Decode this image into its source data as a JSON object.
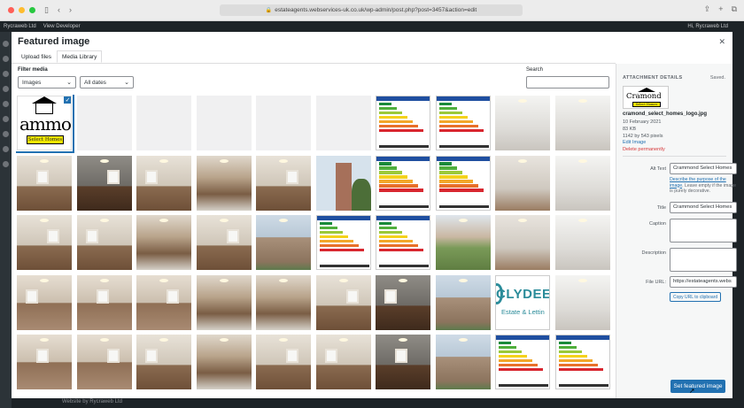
{
  "browser": {
    "url": "estateagents.webservices-uk.co.uk/wp-admin/post.php?post=3457&action=edit"
  },
  "admin_bar": {
    "site_name": "Rycraweb Ltd",
    "view_developer": "View Developer",
    "greeting": "Hi, Rycraweb Ltd"
  },
  "footer_text": "Website by Rycraweb Ltd",
  "modal": {
    "title": "Featured image",
    "tabs": [
      {
        "label": "Upload files",
        "active": false
      },
      {
        "label": "Media Library",
        "active": true
      }
    ],
    "filter_label": "Filter media",
    "filter_type": "Images",
    "filter_date": "All dates",
    "search_label": "Search"
  },
  "grid": {
    "columns": 10,
    "items": [
      {
        "kind": "logo",
        "text": "ammo",
        "bar": "Select Homes",
        "selected": true
      },
      {
        "kind": "blank"
      },
      {
        "kind": "blank"
      },
      {
        "kind": "blank"
      },
      {
        "kind": "blank"
      },
      {
        "kind": "blank"
      },
      {
        "kind": "epc"
      },
      {
        "kind": "epc"
      },
      {
        "kind": "bath"
      },
      {
        "kind": "bath"
      },
      {
        "kind": "room-light"
      },
      {
        "kind": "room-dark"
      },
      {
        "kind": "room-light"
      },
      {
        "kind": "kitchen"
      },
      {
        "kind": "room-light"
      },
      {
        "kind": "tower"
      },
      {
        "kind": "epc"
      },
      {
        "kind": "epc"
      },
      {
        "kind": "hall"
      },
      {
        "kind": "bath"
      },
      {
        "kind": "room-light"
      },
      {
        "kind": "room-light"
      },
      {
        "kind": "kitchen"
      },
      {
        "kind": "room-light"
      },
      {
        "kind": "building"
      },
      {
        "kind": "epc"
      },
      {
        "kind": "epc"
      },
      {
        "kind": "garden"
      },
      {
        "kind": "hall"
      },
      {
        "kind": "bath"
      },
      {
        "kind": "bed"
      },
      {
        "kind": "bed"
      },
      {
        "kind": "bed"
      },
      {
        "kind": "kitchen"
      },
      {
        "kind": "kitchen"
      },
      {
        "kind": "room-light"
      },
      {
        "kind": "room-dark"
      },
      {
        "kind": "building"
      },
      {
        "kind": "clyde",
        "top": "CLYDEE",
        "bottom": "Estate & Lettin"
      },
      {
        "kind": "bath"
      },
      {
        "kind": "bed"
      },
      {
        "kind": "bed"
      },
      {
        "kind": "room-light"
      },
      {
        "kind": "kitchen"
      },
      {
        "kind": "room-light"
      },
      {
        "kind": "room-light"
      },
      {
        "kind": "room-dark"
      },
      {
        "kind": "building"
      },
      {
        "kind": "epc"
      },
      {
        "kind": "epc"
      }
    ]
  },
  "details": {
    "heading": "ATTACHMENT DETAILS",
    "saved": "Saved.",
    "thumb_text": "Cramond",
    "thumb_bar": "Select Homes",
    "file_name": "cramond_select_homes_logo.jpg",
    "date": "10 February 2021",
    "size": "83 KB",
    "dimensions": "1142 by 543 pixels",
    "edit_link": "Edit Image",
    "delete_link": "Delete permanently",
    "alt_label": "Alt Text",
    "alt_value": "Crammond Select Homes",
    "alt_help_link": "Describe the purpose of the image",
    "alt_help_rest": ". Leave empty if the image is purely decorative.",
    "title_label": "Title",
    "title_value": "Crammond Select Homes",
    "caption_label": "Caption",
    "description_label": "Description",
    "url_label": "File URL:",
    "url_value": "https://estateagents.webs",
    "copy_button": "Copy URL to clipboard"
  },
  "primary_button": "Set featured image"
}
